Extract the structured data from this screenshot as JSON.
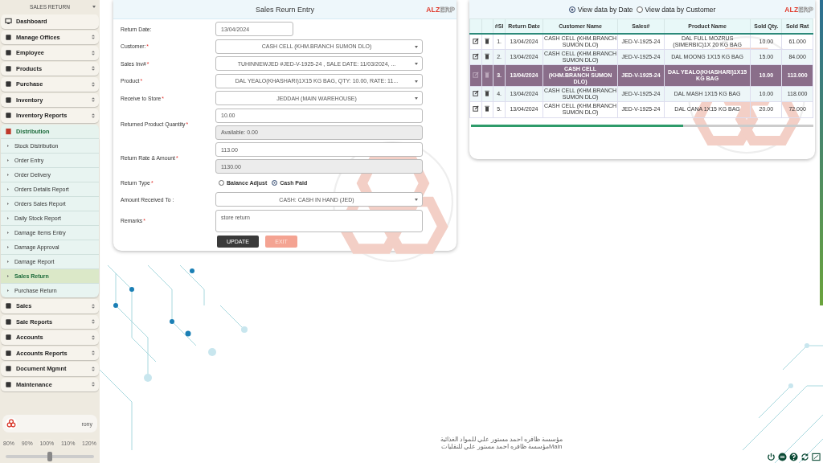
{
  "sidebar": {
    "header": "SALES RETURN",
    "items": [
      {
        "label": "Dashboard",
        "expandable": false,
        "expanded": false
      },
      {
        "label": "Manage Offices",
        "expandable": true,
        "expanded": false
      },
      {
        "label": "Employee",
        "expandable": true,
        "expanded": false
      },
      {
        "label": "Products",
        "expandable": true,
        "expanded": false
      },
      {
        "label": "Purchase",
        "expandable": true,
        "expanded": false
      },
      {
        "label": "Inventory",
        "expandable": true,
        "expanded": false
      },
      {
        "label": "Inventory Reports",
        "expandable": true,
        "expanded": false
      },
      {
        "label": "Distribution",
        "expandable": true,
        "expanded": true,
        "children": [
          {
            "label": "Stock Distribution",
            "selected": false
          },
          {
            "label": "Order Entry",
            "selected": false
          },
          {
            "label": "Order Delivery",
            "selected": false
          },
          {
            "label": "Orders Details Report",
            "selected": false
          },
          {
            "label": "Orders Sales Report",
            "selected": false
          },
          {
            "label": "Daily Stock Report",
            "selected": false
          },
          {
            "label": "Damage Items Entry",
            "selected": false
          },
          {
            "label": "Damage Approval",
            "selected": false
          },
          {
            "label": "Damage Report",
            "selected": false
          },
          {
            "label": "Sales Return",
            "selected": true
          },
          {
            "label": "Purchase Return",
            "selected": false
          }
        ]
      },
      {
        "label": "Sales",
        "expandable": true,
        "expanded": false
      },
      {
        "label": "Sale Reports",
        "expandable": true,
        "expanded": false
      },
      {
        "label": "Accounts",
        "expandable": true,
        "expanded": false
      },
      {
        "label": "Accounts Reports",
        "expandable": true,
        "expanded": false
      },
      {
        "label": "Document Mgmnt",
        "expandable": true,
        "expanded": false
      },
      {
        "label": "Maintenance",
        "expandable": true,
        "expanded": false
      }
    ],
    "user": "rony",
    "zoom_levels": [
      "80%",
      "90%",
      "100%",
      "110%",
      "120%"
    ],
    "zoom": {
      "level": 0.5
    }
  },
  "form": {
    "title": "Sales Reurn Entry",
    "brand": {
      "first": "ALZ",
      "second": "ERP"
    },
    "fields": [
      {
        "label": "Return Date:",
        "required": false,
        "inputs": [
          {
            "kind": "date",
            "value": "13/04/2024"
          }
        ]
      },
      {
        "label": "Customer:",
        "required": true,
        "inputs": [
          {
            "kind": "select",
            "value": "CASH CELL (KHM.BRANCH SUMON DLO)"
          }
        ]
      },
      {
        "label": "Sales Inv#",
        "required": true,
        "inputs": [
          {
            "kind": "select",
            "value": "TUHINNEWJED #JED-V-1925-24 , SALE DATE: 11/03/2024, ..."
          }
        ]
      },
      {
        "label": "Product",
        "required": true,
        "inputs": [
          {
            "kind": "select",
            "value": "DAL YEALO(KHASHARI)1X15 KG BAG, QTY: 10.00, RATE: 11..."
          }
        ]
      },
      {
        "label": "Receive to Store",
        "required": true,
        "inputs": [
          {
            "kind": "select",
            "value": "JEDDAH (MAIN WAREHOUSE)"
          }
        ]
      },
      {
        "label": "Returned Product Quantity",
        "required": true,
        "inputs": [
          {
            "kind": "text",
            "value": "10.00"
          },
          {
            "kind": "readonly",
            "value": "Available: 0.00"
          }
        ]
      },
      {
        "label": "Return Rate & Amount",
        "required": true,
        "inputs": [
          {
            "kind": "text",
            "value": "113.00"
          },
          {
            "kind": "readonly",
            "value": "1130.00"
          }
        ]
      },
      {
        "label": "Return Type",
        "required": true,
        "inputs": [
          {
            "kind": "radio",
            "options": [
              {
                "label": "Balance Adjust",
                "selected": false
              },
              {
                "label": "Cash Paid",
                "selected": true
              }
            ]
          }
        ]
      },
      {
        "label": "Amount Received To :",
        "required": false,
        "inputs": [
          {
            "kind": "select",
            "value": "CASH: CASH IN HAND (JED)"
          }
        ]
      },
      {
        "label": "Remarks",
        "required": true,
        "inputs": [
          {
            "kind": "textarea",
            "value": "store return"
          }
        ]
      }
    ],
    "required_mark": "*",
    "buttons": [
      {
        "label": "UPDATE",
        "disabled": false
      },
      {
        "label": "EXIT",
        "disabled": true
      }
    ]
  },
  "table": {
    "brand": {
      "first": "ALZ",
      "second": "ERP"
    },
    "view_options": [
      {
        "label": "View data by Date",
        "selected": true
      },
      {
        "label": "View data by Customer",
        "selected": false
      }
    ],
    "columns": [
      "#Sl",
      "Return Date",
      "Customer Name",
      "Sales#",
      "Product Name",
      "Sold Qty.",
      "Sold Rat"
    ],
    "rows": [
      {
        "sl": "1.",
        "date": "13/04/2024",
        "customer": "CASH CELL (KHM.BRANCH SUMON DLO)",
        "sales": "JED-V-1925-24",
        "product": "DAL FULL MOZRUS (SIMERBIC)1X 20 KG BAG",
        "qty": "10.00",
        "rate": "61.000",
        "selected": false
      },
      {
        "sl": "2.",
        "date": "13/04/2024",
        "customer": "CASH CELL (KHM.BRANCH SUMON DLO)",
        "sales": "JED-V-1925-24",
        "product": "DAL MOONG 1X15 KG BAG",
        "qty": "15.00",
        "rate": "84.000",
        "selected": false
      },
      {
        "sl": "3.",
        "date": "13/04/2024",
        "customer": "CASH CELL (KHM.BRANCH SUMON DLO)",
        "sales": "JED-V-1925-24",
        "product": "DAL YEALO(KHASHARI)1X15 KG BAG",
        "qty": "10.00",
        "rate": "113.000",
        "selected": true
      },
      {
        "sl": "4.",
        "date": "13/04/2024",
        "customer": "CASH CELL (KHM.BRANCH SUMON DLO)",
        "sales": "JED-V-1925-24",
        "product": "DAL MASH 1X15 KG BAG",
        "qty": "10.00",
        "rate": "118.000",
        "selected": false
      },
      {
        "sl": "5.",
        "date": "13/04/2024",
        "customer": "CASH CELL (KHM.BRANCH SUMON DLO)",
        "sales": "JED-V-1925-24",
        "product": "DAL CANA 1X15 KG BAG",
        "qty": "20.00",
        "rate": "72.000",
        "selected": false
      }
    ]
  },
  "footer": [
    "مؤسسة ظافره احمد مستور علي للمواد الغذائية",
    "Mainمؤسسة ظافره احمد مستور علي للنقليات"
  ]
}
